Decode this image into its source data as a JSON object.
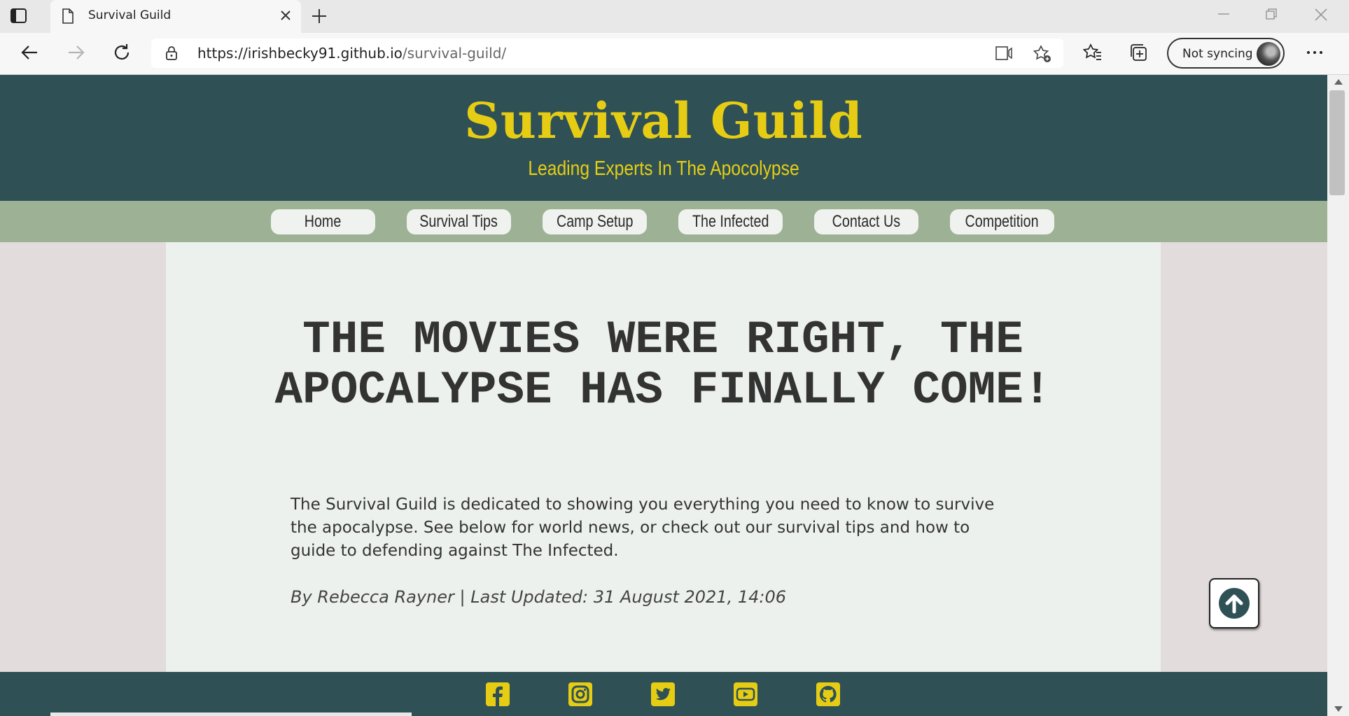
{
  "browser": {
    "tab_title": "Survival Guild",
    "url_host": "https://irishbecky91.github.io",
    "url_path": "/survival-guild/",
    "sync_label": "Not syncing",
    "icons": [
      "tab-actions-icon",
      "page-icon",
      "close-tab-icon",
      "new-tab-icon",
      "minimize-icon",
      "restore-icon",
      "close-window-icon",
      "back-icon",
      "forward-icon",
      "refresh-icon",
      "lock-icon",
      "read-aloud-icon",
      "add-favorite-icon",
      "favorites-icon",
      "collections-icon",
      "more-icon"
    ]
  },
  "site": {
    "title": "Survival Guild",
    "tagline": "Leading Experts In The Apocolypse",
    "nav": [
      "Home",
      "Survival Tips",
      "Camp Setup",
      "The Infected",
      "Contact Us",
      "Competition"
    ],
    "headline_line1": "THE MOVIES WERE RIGHT, THE",
    "headline_line2": "APOCALYPSE HAS FINALLY COME!",
    "intro": "The Survival Guild is dedicated to showing you everything you need to know to survive the apocalypse. See below for world news, or check out our survival tips and how to guide to defending against The Infected.",
    "byline": "By Rebecca Rayner | Last Updated: 31 August 2021, 14:06",
    "social": [
      "facebook-icon",
      "instagram-icon",
      "twitter-icon",
      "youtube-icon",
      "github-icon"
    ]
  },
  "colors": {
    "header_bg": "#2f5156",
    "accent_yellow": "#e6cd14",
    "nav_bg": "#9db194",
    "main_bg": "#edf1ed",
    "page_bg": "#e2dcdc"
  }
}
